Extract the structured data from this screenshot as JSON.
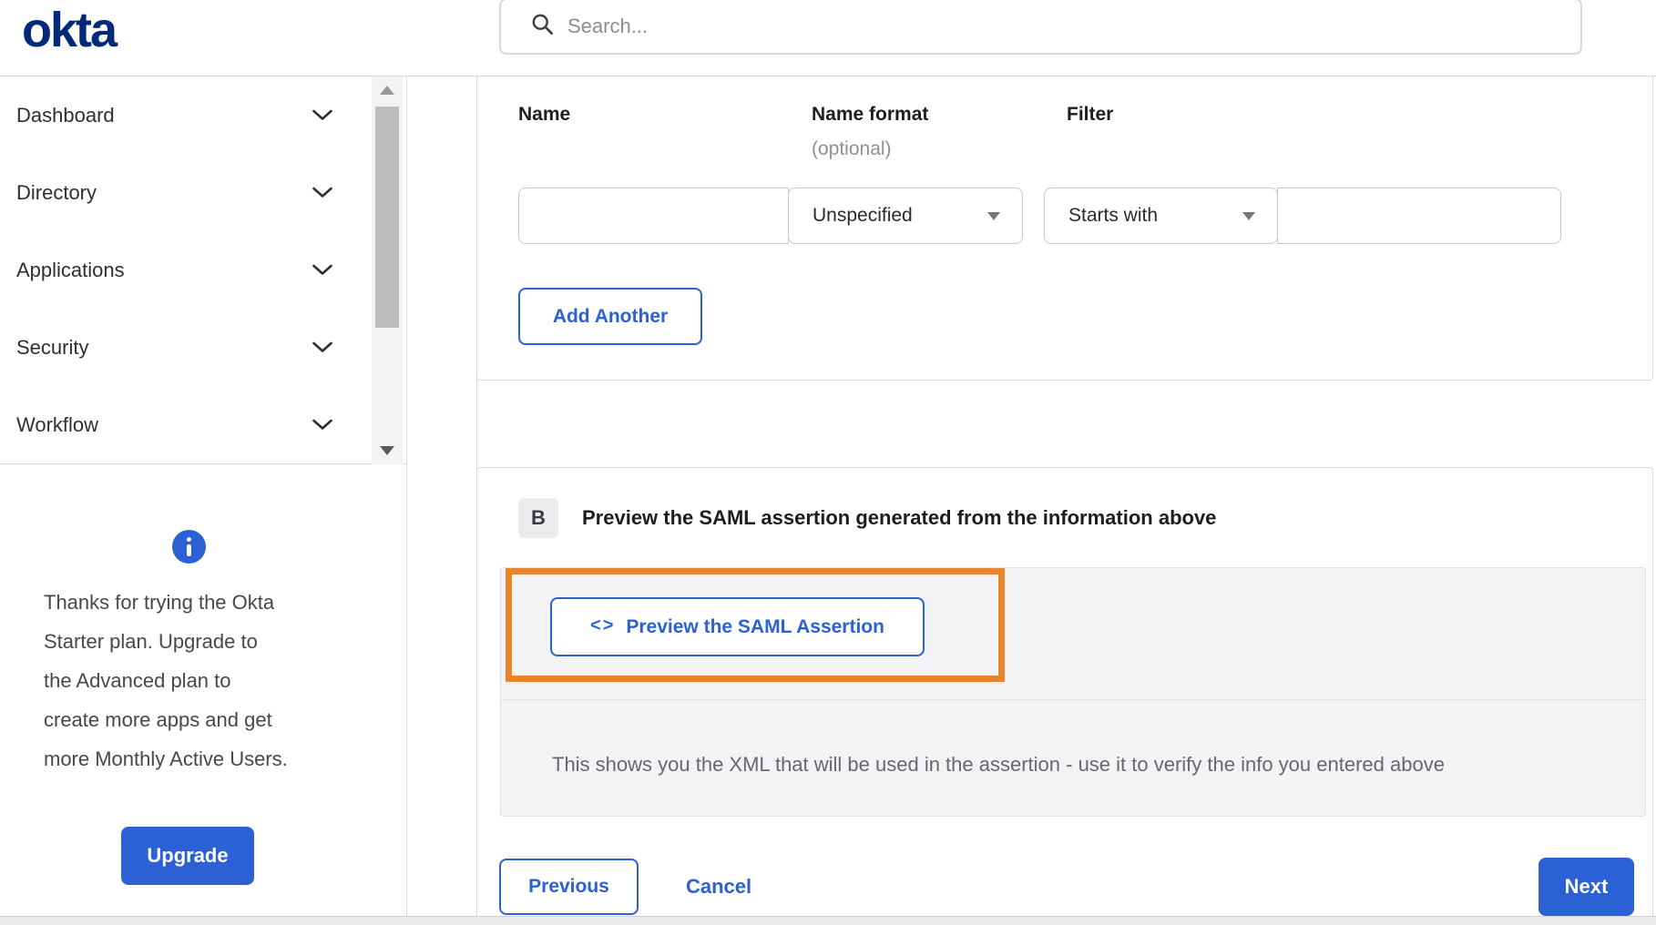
{
  "brand": {
    "logo_text": "okta"
  },
  "search": {
    "placeholder": "Search..."
  },
  "sidebar": {
    "items": [
      {
        "label": "Dashboard"
      },
      {
        "label": "Directory"
      },
      {
        "label": "Applications"
      },
      {
        "label": "Security"
      },
      {
        "label": "Workflow"
      }
    ],
    "upgrade": {
      "message_lines": [
        "Thanks for trying the Okta",
        "Starter plan. Upgrade to",
        "the Advanced plan to",
        "create more apps and get",
        "more Monthly Active Users."
      ],
      "button_label": "Upgrade"
    }
  },
  "attribute_form": {
    "name_label": "Name",
    "name_format_label": "Name format",
    "name_format_hint": "(optional)",
    "filter_label": "Filter",
    "name_value": "",
    "name_format_selected": "Unspecified",
    "filter_selected": "Starts with",
    "filter_value": "",
    "add_another_label": "Add Another"
  },
  "preview_section": {
    "badge": "B",
    "title": "Preview the SAML assertion generated from the information above",
    "code_icon": "<>",
    "preview_button_label": "Preview the SAML Assertion",
    "description": "This shows you the XML that will be used in the assertion - use it to verify the info you entered above"
  },
  "footer": {
    "previous_label": "Previous",
    "cancel_label": "Cancel",
    "next_label": "Next"
  },
  "colors": {
    "accent_blue": "#2b61d5",
    "logo_navy": "#00297a",
    "highlight_orange": "#e8852c"
  }
}
